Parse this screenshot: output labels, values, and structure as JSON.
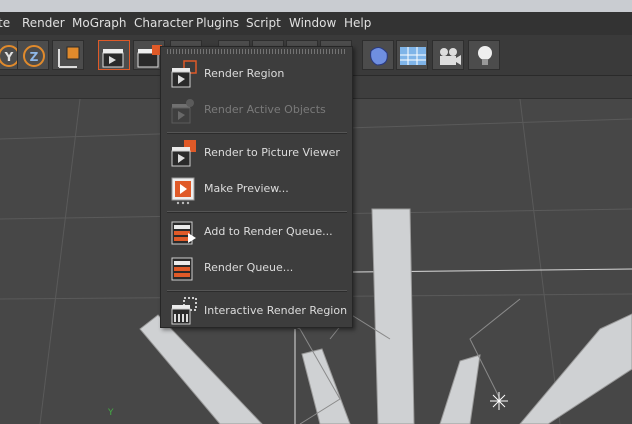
{
  "menubar": {
    "items": [
      {
        "label": "te"
      },
      {
        "label": "Render"
      },
      {
        "label": "MoGraph"
      },
      {
        "label": "Character"
      },
      {
        "label": "Plugins"
      },
      {
        "label": "Script"
      },
      {
        "label": "Window"
      },
      {
        "label": "Help"
      }
    ]
  },
  "toolbar": {
    "buttons": [
      {
        "icon": "y-axis-lock-icon"
      },
      {
        "icon": "z-axis-lock-icon"
      },
      {
        "icon": "coordinate-system-icon"
      },
      {
        "icon": "render-view-icon"
      },
      {
        "icon": "render-to-picture-viewer-icon"
      },
      {
        "icon": "render-settings-icon"
      },
      {
        "icon": "cube-primitive-icon"
      },
      {
        "icon": "subdivision-icon"
      },
      {
        "icon": "array-icon"
      },
      {
        "icon": "generator-icon"
      },
      {
        "icon": "deformer-icon"
      },
      {
        "icon": "floor-icon"
      },
      {
        "icon": "camera-icon"
      },
      {
        "icon": "light-icon"
      }
    ]
  },
  "render_menu": {
    "items": [
      {
        "label": "Render Region",
        "icon": "render-region-icon",
        "enabled": true
      },
      {
        "label": "Render Active Objects",
        "icon": "render-active-objects-icon",
        "enabled": false
      },
      {
        "label": "Render to Picture Viewer",
        "icon": "render-to-picture-viewer-icon",
        "enabled": true
      },
      {
        "label": "Make Preview...",
        "icon": "make-preview-icon",
        "enabled": true
      },
      {
        "label": "Add to Render Queue...",
        "icon": "add-to-render-queue-icon",
        "enabled": true
      },
      {
        "label": "Render Queue...",
        "icon": "render-queue-icon",
        "enabled": true
      },
      {
        "label": "Interactive Render Region",
        "icon": "interactive-render-region-icon",
        "enabled": true
      }
    ]
  },
  "colors": {
    "menubar_bg": "#333333",
    "toolbar_bg": "#3a3a3a",
    "viewport_bg": "#474747",
    "menu_bg": "#3d3d3d",
    "accent_orange": "#e05a28",
    "disabled_text": "#7a7a7a"
  }
}
